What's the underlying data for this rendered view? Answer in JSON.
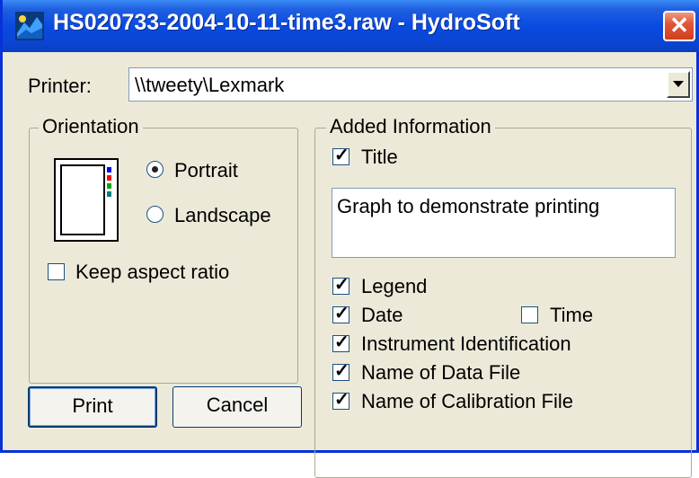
{
  "window": {
    "title": "HS020733-2004-10-11-time3.raw - HydroSoft",
    "close_label": "✕"
  },
  "printer": {
    "label": "Printer:",
    "value": "\\\\tweety\\Lexmark"
  },
  "orientation": {
    "group_label": "Orientation",
    "options": [
      {
        "label": "Portrait",
        "selected": true
      },
      {
        "label": "Landscape",
        "selected": false
      }
    ],
    "keep_aspect": {
      "label": "Keep aspect ratio",
      "checked": false
    },
    "preview_colors": [
      "#0000ff",
      "#ff0000",
      "#00aa00",
      "#008080"
    ]
  },
  "added_info": {
    "group_label": "Added Information",
    "title": {
      "label": "Title",
      "checked": true
    },
    "title_text": "Graph to demonstrate printing",
    "legend": {
      "label": "Legend",
      "checked": true
    },
    "date": {
      "label": "Date",
      "checked": true
    },
    "time": {
      "label": "Time",
      "checked": false
    },
    "instrument": {
      "label": "Instrument Identification",
      "checked": true
    },
    "data_file": {
      "label": "Name of Data File",
      "checked": true
    },
    "calibration_file": {
      "label": "Name of Calibration File",
      "checked": true
    }
  },
  "buttons": {
    "print": "Print",
    "cancel": "Cancel"
  }
}
